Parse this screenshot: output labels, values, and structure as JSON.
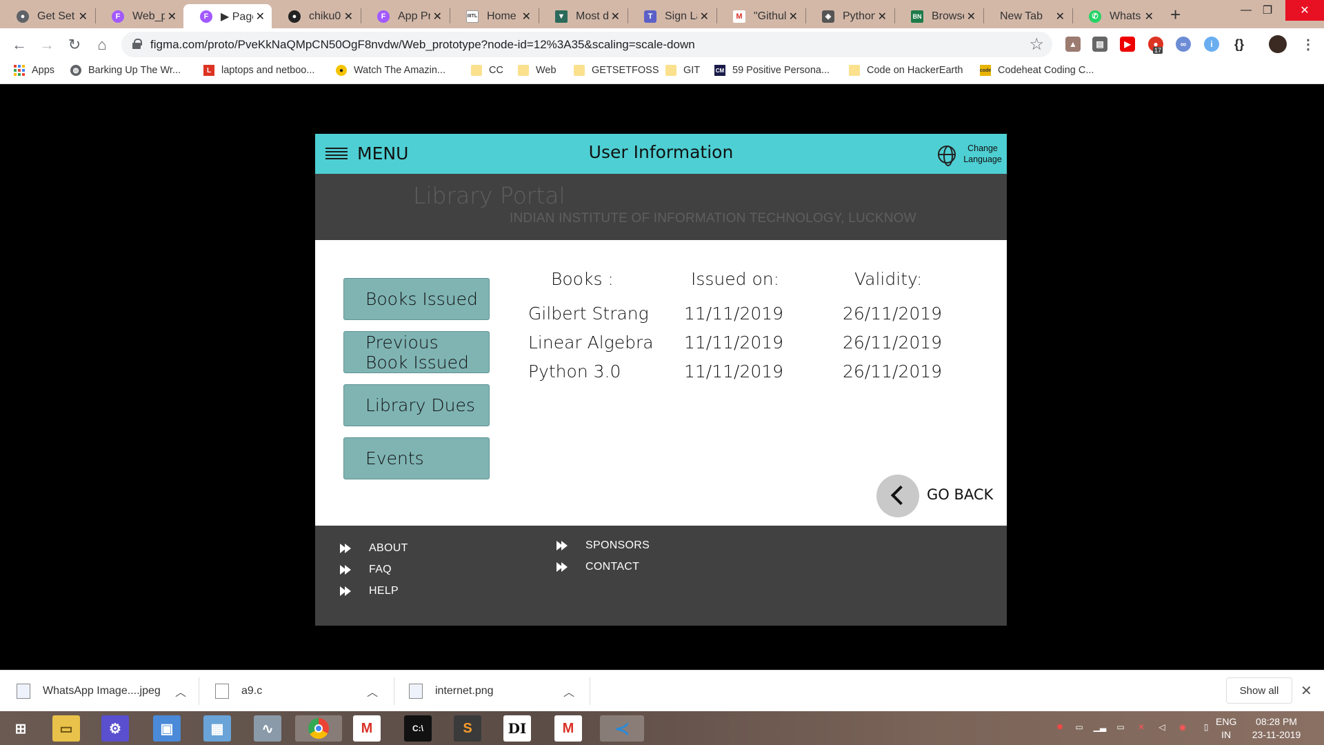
{
  "browser": {
    "tabs": [
      {
        "label": "Get Set",
        "icon": "github-icon",
        "color": "#5f6368"
      },
      {
        "label": "Web_p",
        "icon": "figma-icon",
        "color": "#a259ff"
      },
      {
        "label": "▶ Page",
        "icon": "figma-icon",
        "color": "#a259ff",
        "active": true
      },
      {
        "label": "chiku0",
        "icon": "github-icon",
        "color": "#222222"
      },
      {
        "label": "App Pr",
        "icon": "figma-icon",
        "color": "#a259ff"
      },
      {
        "label": "Home",
        "icon": "iiitl-icon",
        "color": "#ffffff"
      },
      {
        "label": "Most d",
        "icon": "vercel-icon",
        "color": "#2b6a5a"
      },
      {
        "label": "Sign La",
        "icon": "teams-icon",
        "color": "#5b5fc7"
      },
      {
        "label": "\"Githul",
        "icon": "gmail-icon",
        "color": "#d93025"
      },
      {
        "label": "Python",
        "icon": "python-icon",
        "color": "#555555"
      },
      {
        "label": "Browse",
        "icon": "bn-icon",
        "color": "#1e7b4a"
      },
      {
        "label": "New Tab",
        "icon": "",
        "color": ""
      },
      {
        "label": "Whats",
        "icon": "whatsapp-icon",
        "color": "#25d366"
      }
    ],
    "url": "figma.com/proto/PveKkNaQMpCN50OgF8nvdw/Web_prototype?node-id=12%3A35&scaling=scale-down",
    "bookmarks": [
      {
        "label": "Apps",
        "icon": "apps-grid-icon"
      },
      {
        "label": "Barking Up The Wr...",
        "icon": "globe-icon"
      },
      {
        "label": "laptops and netboo...",
        "icon": "l-icon"
      },
      {
        "label": "Watch The Amazin...",
        "icon": "bee-icon"
      },
      {
        "label": "CC",
        "icon": "folder-icon"
      },
      {
        "label": "Web",
        "icon": "folder-icon"
      },
      {
        "label": "GETSETFOSS",
        "icon": "folder-icon"
      },
      {
        "label": "GIT",
        "icon": "folder-icon"
      },
      {
        "label": "59 Positive Persona...",
        "icon": "cm-icon"
      },
      {
        "label": "Code on HackerEarth",
        "icon": "folder-icon"
      },
      {
        "label": "Codeheat Coding C...",
        "icon": "codeheat-icon"
      }
    ],
    "extension_badge": "17"
  },
  "app": {
    "menu_label": "MENU",
    "page_title": "User Information",
    "change_language": "Change Language",
    "portal_title": "Library Portal",
    "portal_subtitle": "INDIAN INSTITUTE OF INFORMATION TECHNOLOGY, LUCKNOW",
    "sidebar": [
      {
        "label": "Books Issued"
      },
      {
        "label": "Previous Book Issued"
      },
      {
        "label": "Library Dues"
      },
      {
        "label": "Events"
      }
    ],
    "table": {
      "headers": [
        "Books :",
        "Issued on:",
        "Validity:"
      ],
      "rows": [
        [
          "Gilbert Strang",
          "11/11/2019",
          "26/11/2019"
        ],
        [
          "Linear Algebra",
          "11/11/2019",
          "26/11/2019"
        ],
        [
          "Python 3.0",
          "11/11/2019",
          "26/11/2019"
        ]
      ]
    },
    "go_back": "GO BACK",
    "footer": {
      "col1": [
        "ABOUT",
        "FAQ",
        "HELP"
      ],
      "col2": [
        "SPONSORS",
        "CONTACT"
      ]
    },
    "colors": {
      "topbar": "#4ecfd3",
      "band": "#414141",
      "button": "#7fb4b3"
    }
  },
  "downloads": [
    {
      "name": "WhatsApp Image....jpeg"
    },
    {
      "name": "a9.c"
    },
    {
      "name": "internet.png"
    }
  ],
  "downloads_show_all": "Show all",
  "taskbar": {
    "lang_line1": "ENG",
    "lang_line2": "IN",
    "time": "08:28 PM",
    "date": "23-11-2019"
  }
}
